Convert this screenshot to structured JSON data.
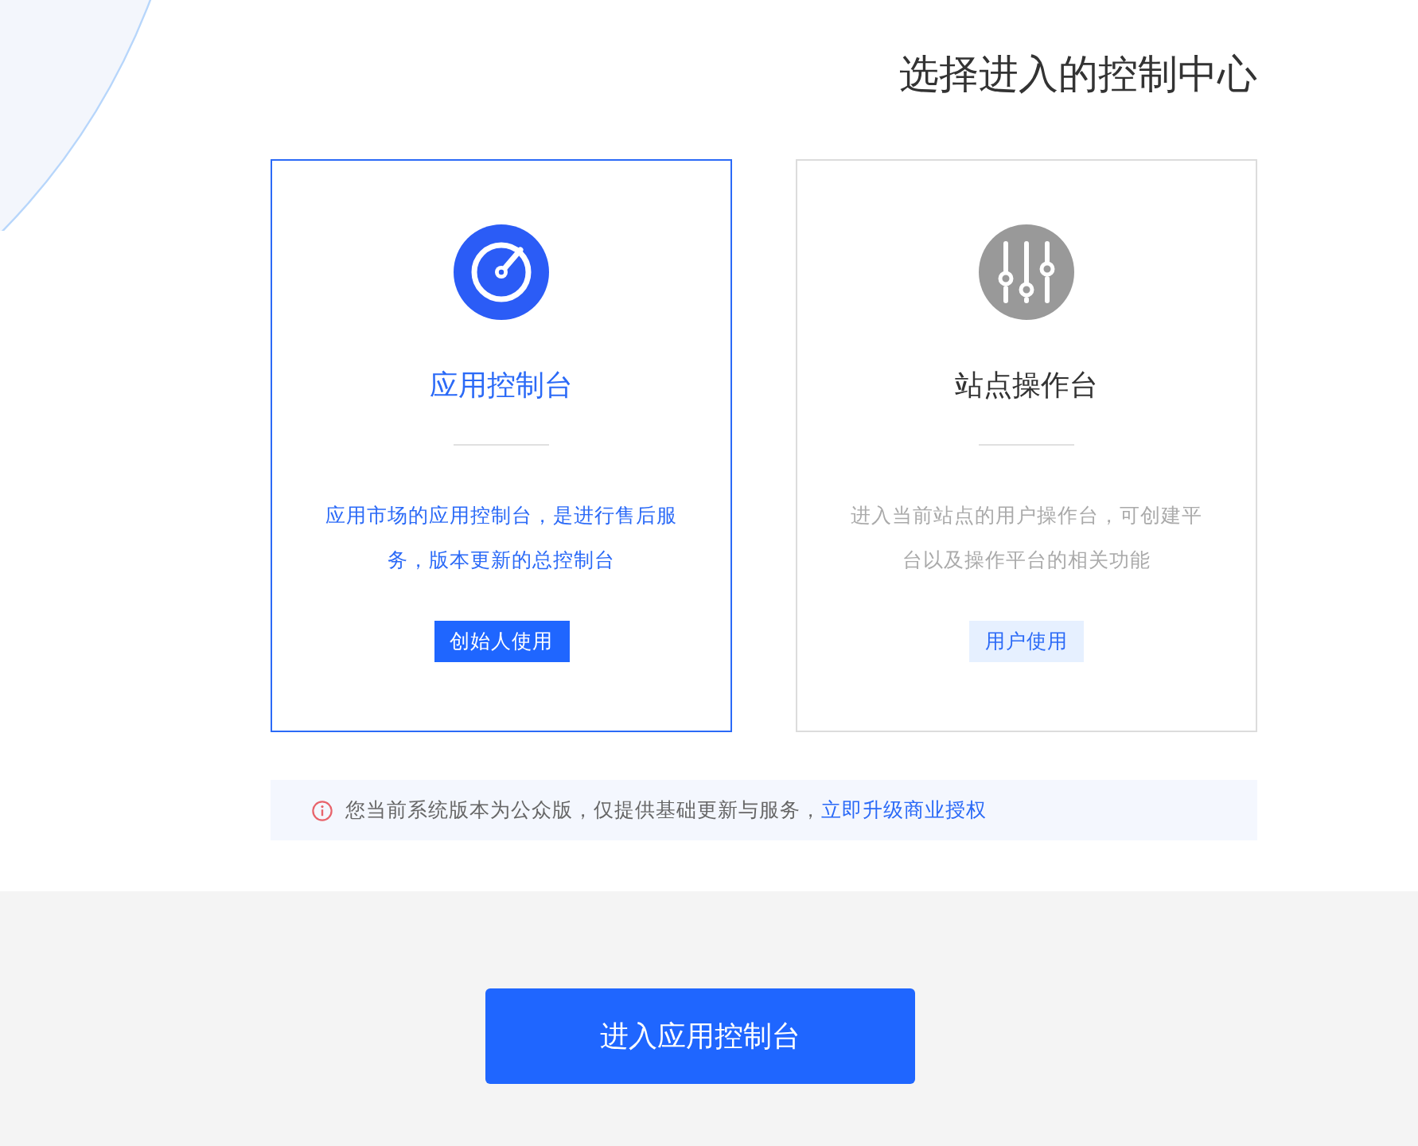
{
  "heading": "选择进入的控制中心",
  "cards": [
    {
      "kind": "gauge",
      "title": "应用控制台",
      "description": "应用市场的应用控制台，是进行售后服务，版本更新的总控制台",
      "badge": "创始人使用",
      "selected": true
    },
    {
      "kind": "sliders",
      "title": "站点操作台",
      "description": "进入当前站点的用户操作台，可创建平台以及操作平台的相关功能",
      "badge": "用户使用",
      "selected": false
    }
  ],
  "notice": {
    "text": "您当前系统版本为公众版，仅提供基础更新与服务，",
    "link": "立即升级商业授权"
  },
  "enter_button": "进入应用控制台"
}
